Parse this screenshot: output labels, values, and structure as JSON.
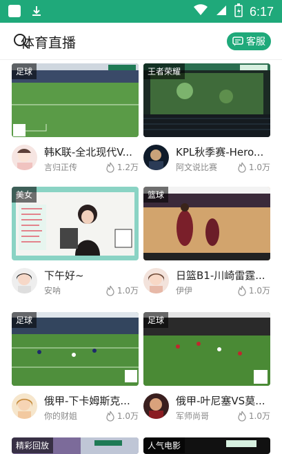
{
  "status": {
    "time": "6:17"
  },
  "header": {
    "title": "体育直播",
    "cs_label": "客服"
  },
  "cards": [
    {
      "tag": "足球",
      "title": "韩K联-全北现代V...",
      "author": "言归正传",
      "views": "1.2万"
    },
    {
      "tag": "王者荣耀",
      "title": "KPL秋季赛-Hero...",
      "author": "阿文说比赛",
      "views": "1.0万"
    },
    {
      "tag": "美女",
      "title": "下午好~",
      "author": "安呐",
      "views": "1.0万"
    },
    {
      "tag": "篮球",
      "title": "日篮B1-川崎雷霆...",
      "author": "伊伊",
      "views": "1.0万"
    },
    {
      "tag": "足球",
      "title": "俄甲-下卡姆斯克...",
      "author": "你的财姐",
      "views": "1.0万"
    },
    {
      "tag": "足球",
      "title": "俄甲-叶尼塞VS莫...",
      "author": "军师尚哥",
      "views": "1.0万"
    },
    {
      "tag": "精彩回放"
    },
    {
      "tag": "人气电影"
    }
  ]
}
